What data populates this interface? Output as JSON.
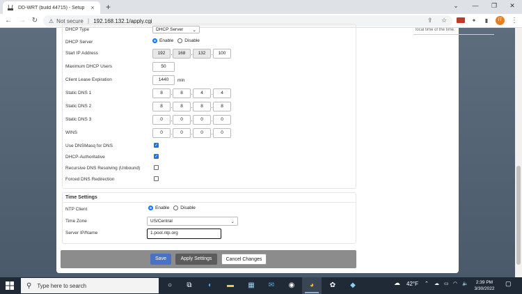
{
  "browser": {
    "tab_title": "DD-WRT (build 44715) - Setup",
    "not_secure": "Not secure",
    "separator": "|",
    "url": "192.168.132.1/apply.cgi"
  },
  "side_panel_text": "local time of the time.",
  "dhcp": {
    "type_label": "DHCP Type",
    "type_value": "DHCP Server",
    "server_label": "DHCP Server",
    "enable": "Enable",
    "disable": "Disable",
    "start_ip_label": "Start IP Address",
    "start_ip": [
      "192",
      "168",
      "132",
      "100"
    ],
    "max_users_label": "Maximum DHCP Users",
    "max_users": "50",
    "lease_label": "Client Lease Expiration",
    "lease": "1440",
    "lease_unit": "min",
    "dns1_label": "Static DNS 1",
    "dns1": [
      "8",
      "8",
      "4",
      "4"
    ],
    "dns2_label": "Static DNS 2",
    "dns2": [
      "8",
      "8",
      "8",
      "8"
    ],
    "dns3_label": "Static DNS 3",
    "dns3": [
      "0",
      "0",
      "0",
      "0"
    ],
    "wins_label": "WINS",
    "wins": [
      "0",
      "0",
      "0",
      "0"
    ],
    "dnsmasq_label": "Use DNSMasq for DNS",
    "authoritative_label": "DHCP-Authoritative",
    "recursive_label": "Recursive DNS Resolving (Unbound)",
    "forced_label": "Forced DNS Redirection"
  },
  "time": {
    "title": "Time Settings",
    "ntp_label": "NTP Client",
    "enable": "Enable",
    "disable": "Disable",
    "zone_label": "Time Zone",
    "zone_value": "US/Central",
    "server_label": "Server IP/Name",
    "server_value": "1.pool.ntp.org"
  },
  "buttons": {
    "save": "Save",
    "apply": "Apply Settings",
    "cancel": "Cancel Changes"
  },
  "taskbar": {
    "search_placeholder": "Type here to search",
    "temperature": "42°F",
    "time": "2:39 PM",
    "date": "3/30/2022"
  },
  "colors": {
    "accent": "#1a73e8",
    "save_button": "#4a72c4",
    "apply_button": "#5c5c5c"
  }
}
